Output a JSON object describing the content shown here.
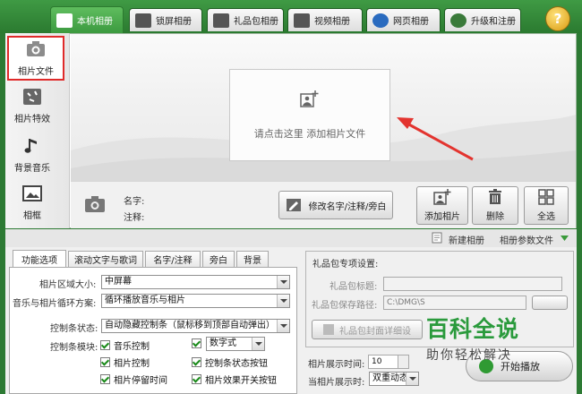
{
  "tabs": [
    {
      "label": "本机相册",
      "icon": "photo-album-icon",
      "active": true
    },
    {
      "label": "锁屏相册",
      "icon": "monitor-icon",
      "active": false
    },
    {
      "label": "礼品包相册",
      "icon": "gift-icon",
      "active": false
    },
    {
      "label": "视频相册",
      "icon": "film-icon",
      "active": false
    },
    {
      "label": "网页相册",
      "icon": "ie-icon",
      "active": false
    },
    {
      "label": "升级和注册",
      "icon": "globe-icon",
      "active": false
    }
  ],
  "help_label": "?",
  "sidebar": {
    "items": [
      {
        "label": "相片文件",
        "icon": "camera-icon",
        "selected": true
      },
      {
        "label": "相片特效",
        "icon": "effects-icon",
        "selected": false
      },
      {
        "label": "背景音乐",
        "icon": "music-note-icon",
        "selected": false
      },
      {
        "label": "相框",
        "icon": "frame-icon",
        "selected": false
      }
    ]
  },
  "canvas": {
    "add_prompt": "请点击这里  添加相片文件"
  },
  "info": {
    "name_label": "名字:",
    "note_label": "注释:"
  },
  "actions": {
    "edit_label": "修改名字/注释/旁白",
    "add_photo": "添加相片",
    "delete": "删除",
    "select_all": "全选"
  },
  "strip2": {
    "new_album": "新建相册",
    "params_file": "相册参数文件"
  },
  "subtabs": [
    "功能选项",
    "滚动文字与歌词",
    "名字/注释",
    "旁白",
    "背景"
  ],
  "options": {
    "area_size_label": "相片区域大小:",
    "area_size_value": "中屏幕",
    "loop_label": "音乐与相片循环方案:",
    "loop_value": "循环播放音乐与相片",
    "control_state_label": "控制条状态:",
    "control_state_value": "自动隐藏控制条（鼠标移到顶部自动弹出）",
    "control_module_label": "控制条模块:",
    "checks": [
      "音乐控制",
      "数字式",
      "相片控制",
      "控制条状态按钮",
      "相片停留时间",
      "相片效果开关按钮"
    ]
  },
  "gift": {
    "title": "礼品包专项设置:",
    "title_label": "礼品包标题:",
    "path_label": "礼品包保存路径:",
    "path_value": "C:\\DMG\\S",
    "button": "礼品包封面详细设"
  },
  "timing": {
    "display_time_label": "相片展示时间:",
    "display_time_value": "10",
    "display_mode_label": "当相片展示时:",
    "display_mode_value": "双重动态"
  },
  "play_label": "开始播放",
  "watermark": {
    "line1": "百科全说",
    "line2": "助你轻松解决"
  },
  "colors": {
    "brand_green": "#3f9a44",
    "highlight_red": "#e02a2a",
    "annotation_red": "#e3342f"
  }
}
